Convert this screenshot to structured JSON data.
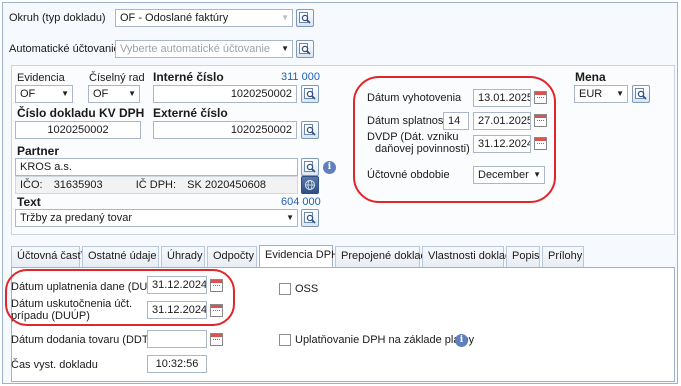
{
  "header": {
    "okruh_label": "Okruh (typ dokladu)",
    "okruh_value": "OF - Odoslané faktúry",
    "auto_label": "Automatické účtovanie",
    "auto_placeholder": "Vyberte automatické účtovanie"
  },
  "doc": {
    "evidencia_label": "Evidencia",
    "evidencia_value": "OF",
    "ciselny_rad_label": "Číselný rad",
    "ciselny_rad_value": "OF",
    "interne_cislo_label": "Interné číslo",
    "interne_cislo_count": "311 000",
    "interne_cislo_value": "1020250002",
    "kv_dph_label": "Číslo dokladu KV DPH",
    "kv_dph_value": "1020250002",
    "externe_cislo_label": "Externé číslo",
    "externe_cislo_value": "1020250002"
  },
  "partner": {
    "label": "Partner",
    "name": "KROS a.s.",
    "ico_label": "IČO:",
    "ico_value": "31635903",
    "ic_dph_label": "IČ DPH:",
    "ic_dph_value": "SK 2020450608",
    "info_icon": "i"
  },
  "text_section": {
    "label": "Text",
    "count": "604 000",
    "value": "Tržby za predaný tovar"
  },
  "dates": {
    "vyhotovenia_label": "Dátum vyhotovenia",
    "vyhotovenia_value": "13.01.2025",
    "splatnosti_label": "Dátum splatnosti",
    "splatnosti_days": "14",
    "splatnosti_value": "27.01.2025",
    "dvdp_label_1": "DVDP (Dát. vzniku",
    "dvdp_label_2": "daňovej povinnosti)",
    "dvdp_value": "31.12.2024",
    "obdobie_label": "Účtovné obdobie",
    "obdobie_value": "December"
  },
  "currency": {
    "label": "Mena",
    "value": "EUR"
  },
  "tabs": [
    {
      "label": "Účtovná časť"
    },
    {
      "label": "Ostatné údaje"
    },
    {
      "label": "Úhrady"
    },
    {
      "label": "Odpočty"
    },
    {
      "label": "Evidencia DPH"
    },
    {
      "label": "Prepojené doklady"
    },
    {
      "label": "Vlastnosti dokladu"
    },
    {
      "label": "Popis"
    },
    {
      "label": "Prílohy"
    }
  ],
  "dph": {
    "dud_label": "Dátum uplatnenia dane (DUD)",
    "dud_value": "31.12.2024",
    "duup_label_1": "Dátum uskutočnenia účt.",
    "duup_label_2": "prípadu (DUÚP)",
    "duup_value": "31.12.2024",
    "ddt_label": "Dátum dodania tovaru (DDT)",
    "ddt_value": "",
    "cas_label": "Čas vyst. dokladu",
    "cas_value": "10:32:56",
    "oss_label": "OSS",
    "platby_label": "Uplatňovanie DPH na základe platby"
  },
  "colors": {
    "accent_blue": "#1f5fb4",
    "highlight_red": "#e0262b",
    "border": "#9db3cc"
  },
  "icons": {
    "search": "search-icon",
    "calendar": "calendar-icon",
    "info": "info-icon",
    "dropdown": "chevron-down-icon"
  }
}
